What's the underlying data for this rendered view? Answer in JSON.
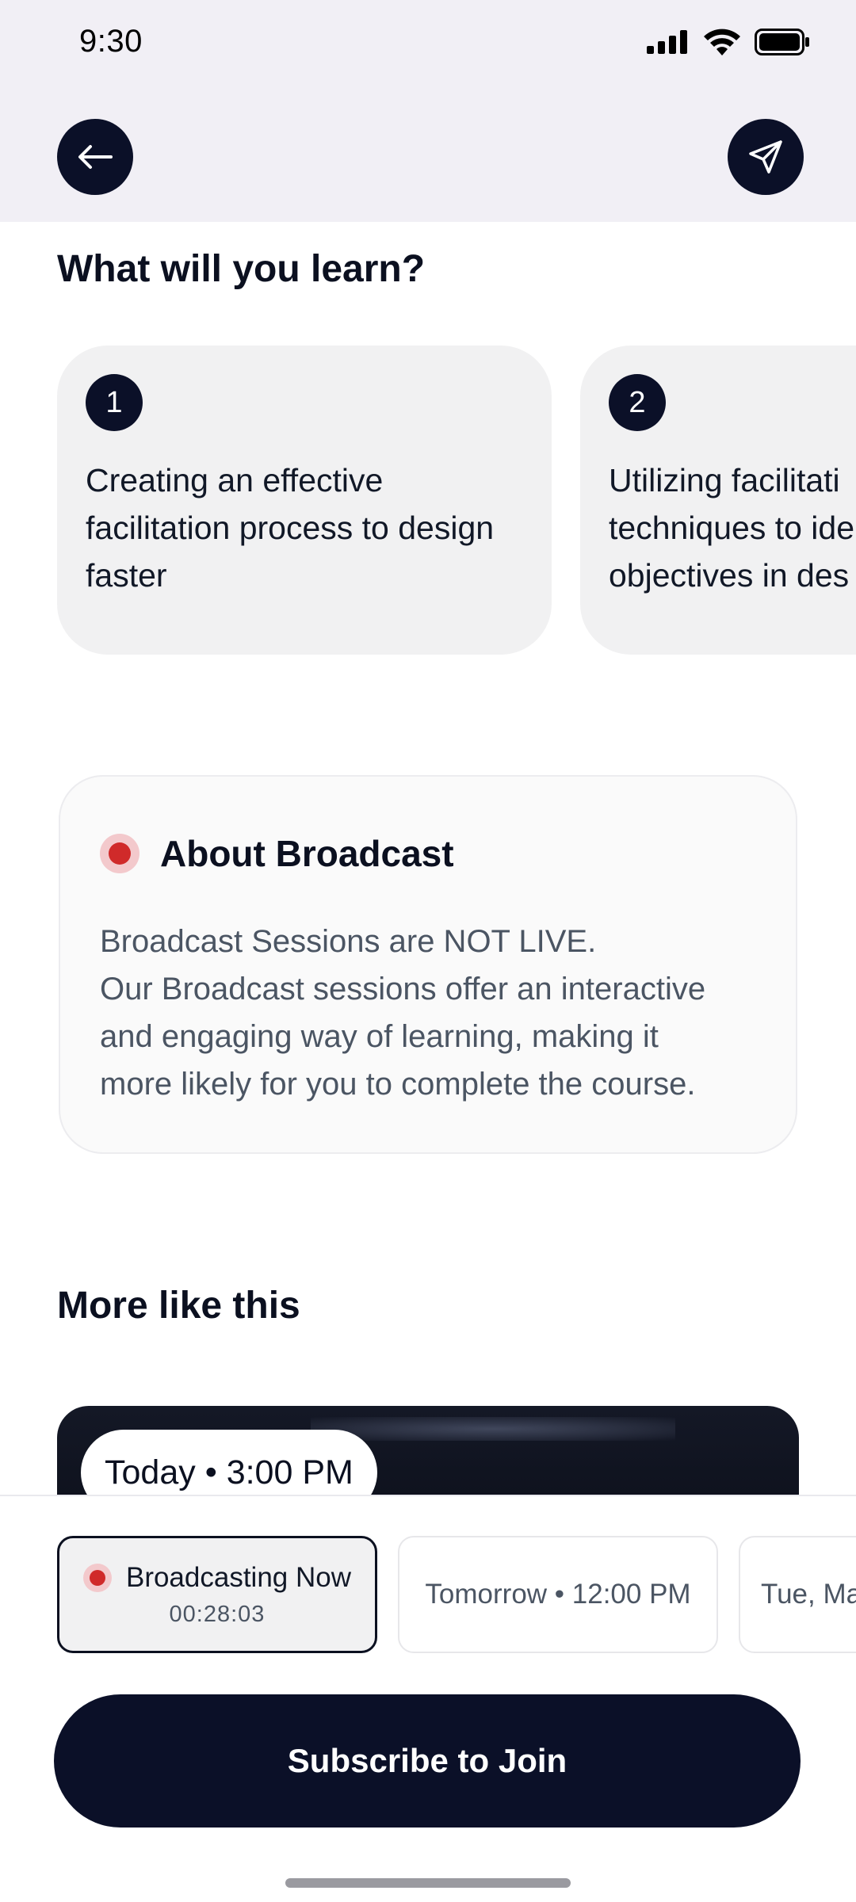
{
  "status_bar": {
    "time": "9:30"
  },
  "header": {
    "back_icon": "arrow-left-icon",
    "share_icon": "send-icon"
  },
  "learn": {
    "title": "What will you learn?",
    "items": [
      {
        "number": "1",
        "text_lines": [
          "Creating an effective",
          "facilitation process to design",
          "faster"
        ]
      },
      {
        "number": "2",
        "text_lines": [
          "Utilizing facilitati",
          "techniques to ide",
          "objectives in des"
        ]
      }
    ]
  },
  "about": {
    "title": "About Broadcast",
    "lines": [
      "Broadcast Sessions are NOT LIVE.",
      "Our Broadcast sessions offer an interactive",
      "and engaging way of learning, making it",
      "more likely for you to complete the course."
    ]
  },
  "more": {
    "title": "More like this",
    "card_time": "Today • 3:00 PM"
  },
  "schedule": {
    "chips": [
      {
        "label": "Broadcasting Now",
        "sub": "00:28:03",
        "active": true
      },
      {
        "label": "Tomorrow • 12:00 PM"
      },
      {
        "label": "Tue, Ma"
      }
    ]
  },
  "cta": {
    "label": "Subscribe to Join"
  },
  "colors": {
    "navy": "#0b1028",
    "live_red": "#d02a2a",
    "header_bg": "#f1eff5"
  }
}
